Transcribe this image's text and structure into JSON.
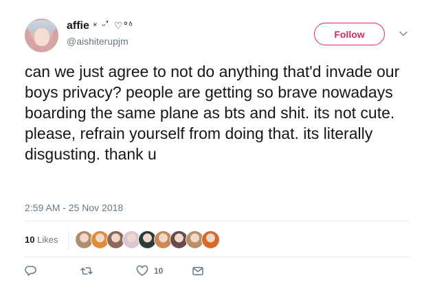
{
  "tweet": {
    "user": {
      "display_name": "affie",
      "name_decoration": "ʶ ᵕ ̓ ♡°ᵒ̇",
      "handle": "@aishiterupjm"
    },
    "follow_label": "Follow",
    "text": "can we just agree to not do anything that'd invade our boys privacy? people are getting so brave nowadays boarding the same plane as bts and shit. its not cute. please, refrain yourself from doing that. its literally disgusting. thank u",
    "timestamp": "2:59 AM - 25 Nov 2018",
    "likes": {
      "count": "10",
      "label": "Likes"
    },
    "liker_avatars": [
      "#b08d6f",
      "#e08a3c",
      "#8c6a58",
      "#d9c7d6",
      "#2f3a37",
      "#c98a58",
      "#6b4a4a",
      "#b8916a",
      "#d66a2a"
    ],
    "actions": {
      "reply_icon": "reply-icon",
      "retweet_icon": "retweet-icon",
      "like_icon": "heart-icon",
      "like_count": "10",
      "dm_icon": "mail-icon"
    },
    "colors": {
      "accent": "#e0245e",
      "text": "#14171a",
      "secondary": "#657786",
      "divider": "#e6ecf0"
    }
  }
}
